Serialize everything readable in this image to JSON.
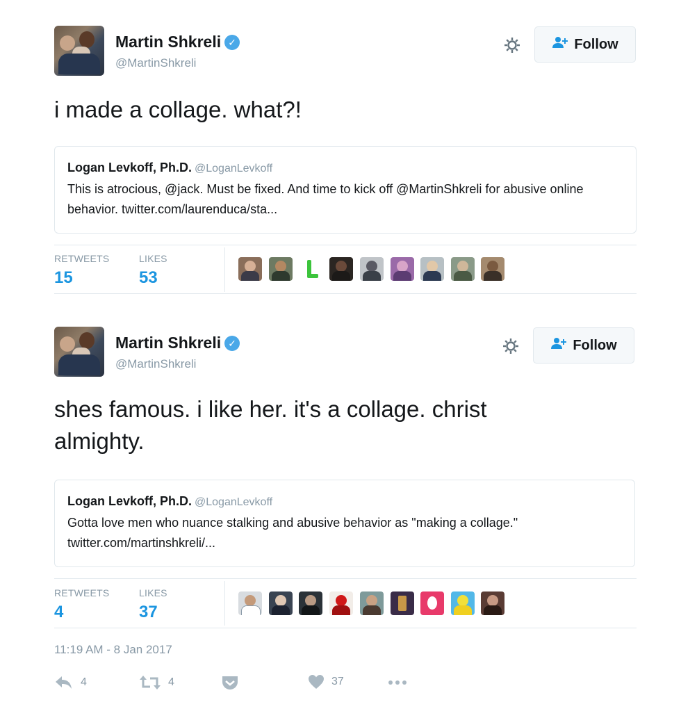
{
  "tweets": [
    {
      "author_name": "Martin Shkreli",
      "author_handle": "@MartinShkreli",
      "follow_label": "Follow",
      "text": "i made a collage. what?!",
      "quote": {
        "name": "Logan Levkoff, Ph.D.",
        "handle": "@LoganLevkoff",
        "text": "This is atrocious, @jack. Must be fixed. And time to kick off @MartinShkreli for abusive online behavior. twitter.com/laurenduca/sta..."
      },
      "retweets_label": "RETWEETS",
      "retweets": "15",
      "likes_label": "LIKES",
      "likes": "53"
    },
    {
      "author_name": "Martin Shkreli",
      "author_handle": "@MartinShkreli",
      "follow_label": "Follow",
      "text": "shes famous. i like her. it's a collage. christ almighty.",
      "quote": {
        "name": "Logan Levkoff, Ph.D.",
        "handle": "@LoganLevkoff",
        "text": "Gotta love men who nuance stalking and abusive behavior as \"making a collage.\" twitter.com/martinshkreli/..."
      },
      "retweets_label": "RETWEETS",
      "retweets": "4",
      "likes_label": "LIKES",
      "likes": "37"
    }
  ],
  "timestamp": "11:19 AM - 8 Jan 2017",
  "actions": {
    "reply_count": "4",
    "retweet_count": "4",
    "like_count": "37"
  },
  "icons": {
    "verified": "verified-badge-icon",
    "gear": "gear-icon",
    "follow": "add-user-icon",
    "reply": "reply-icon",
    "retweet": "retweet-icon",
    "pocket": "pocket-icon",
    "like": "heart-icon",
    "more": "more-icon"
  },
  "colors": {
    "accent": "#1b95e0",
    "verified": "#4aa8e8",
    "muted": "#8899a6",
    "border": "#e1e8ed"
  }
}
